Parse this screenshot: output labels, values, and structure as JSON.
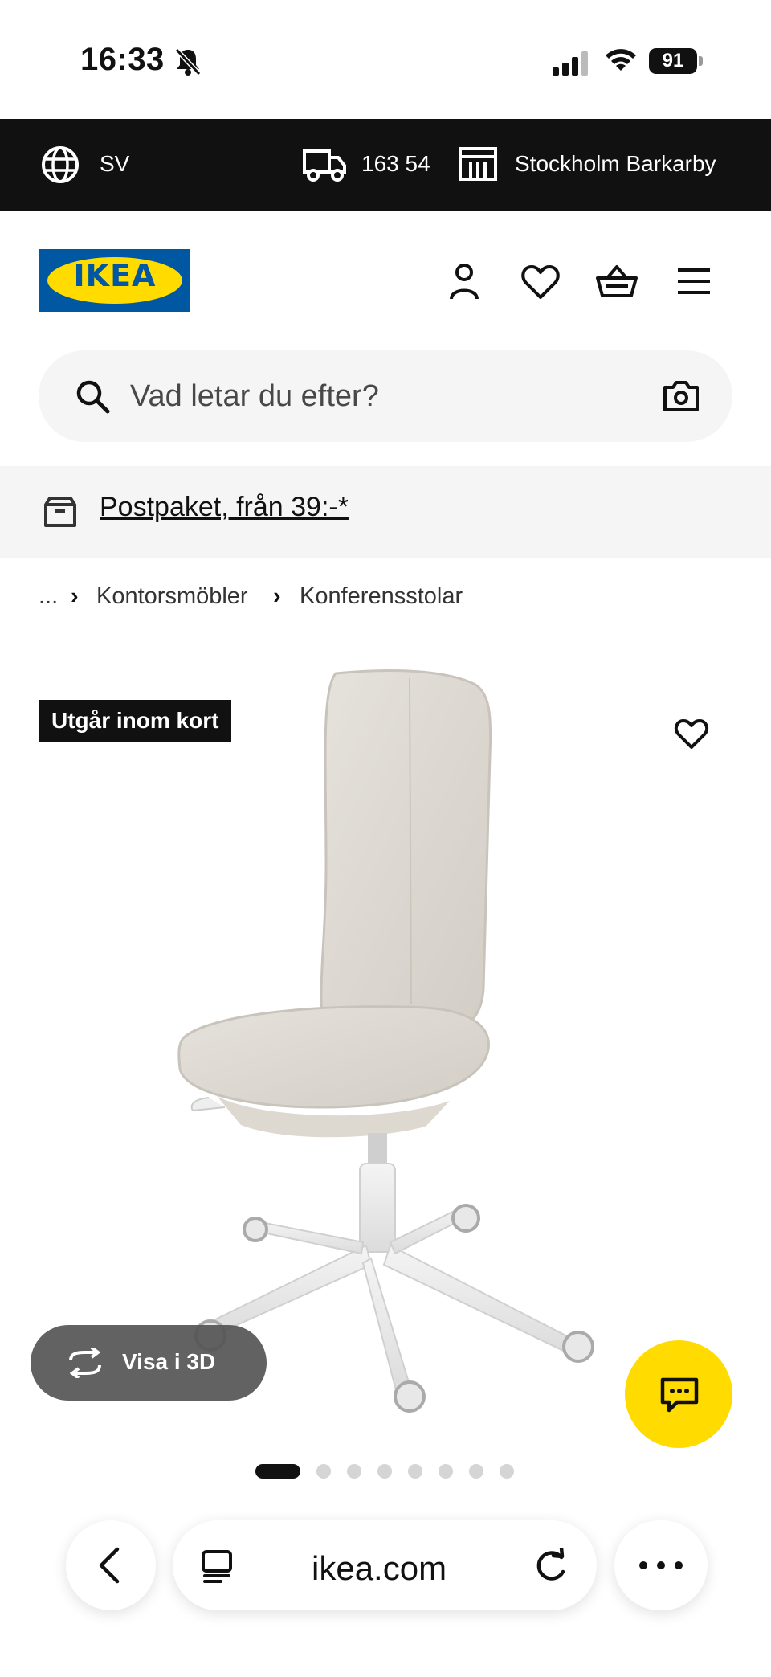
{
  "status_bar": {
    "time": "16:33",
    "battery": "91"
  },
  "top_bar": {
    "language": "SV",
    "postcode": "163 54",
    "store": "Stockholm Barkarby"
  },
  "header": {
    "logo_text": "IKEA"
  },
  "search": {
    "placeholder": "Vad letar du efter?"
  },
  "info_strip": {
    "link": "Postpaket, från 39:-*"
  },
  "breadcrumb": {
    "ellipsis": "...",
    "items": [
      "Kontorsmöbler",
      "Konferensstolar"
    ]
  },
  "product": {
    "badge": "Utgår inom kort",
    "view_3d_label": "Visa i 3D",
    "carousel": {
      "count": 8,
      "active": 0
    }
  },
  "browser": {
    "url": "ikea.com"
  },
  "colors": {
    "brand_blue": "#0058A3",
    "brand_yellow": "#FFDB00",
    "top_bar_bg": "#111111",
    "badge_bg": "#111111"
  }
}
